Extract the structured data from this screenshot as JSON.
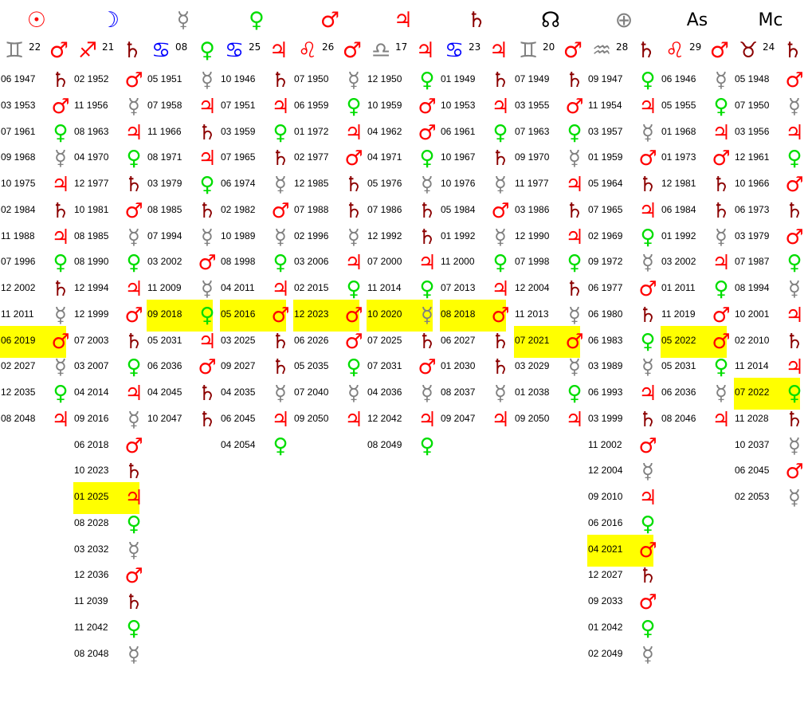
{
  "colors": {
    "sun": "#ff0000",
    "moon": "#0000ff",
    "mercury": "#808080",
    "venus": "#00dd00",
    "mars": "#ff0000",
    "jupiter": "#ff0000",
    "saturn": "#8b0000",
    "node": "#000000",
    "earth": "#808080",
    "asc": "#000000",
    "mc": "#000000",
    "fire": "#ff0000",
    "air": "#808080",
    "water": "#0000ff",
    "earthsign": "#8b0000",
    "highlight": "#ffff00"
  },
  "glyphs": {
    "sun": "☉",
    "moon": "☽",
    "mercury": "☿",
    "venus": "♀",
    "mars": "♂",
    "jupiter": "♃",
    "saturn": "♄",
    "node": "☊",
    "earth": "⊕",
    "asc": "As",
    "mc": "Mc",
    "gemini": "♊",
    "sagittarius": "♐",
    "cancer": "♋",
    "leo": "♌",
    "libra": "♎",
    "aquarius": "♒",
    "taurus": "♉"
  },
  "columns": [
    {
      "point": "sun",
      "point_color": "sun",
      "sign": "gemini",
      "sign_color": "air",
      "degree": "22",
      "ruler": "mars",
      "rows": [
        {
          "date": "06 1947",
          "planet": "saturn"
        },
        {
          "date": "03 1953",
          "planet": "mars"
        },
        {
          "date": "07 1961",
          "planet": "venus"
        },
        {
          "date": "09 1968",
          "planet": "mercury"
        },
        {
          "date": "10 1975",
          "planet": "jupiter"
        },
        {
          "date": "02 1984",
          "planet": "saturn"
        },
        {
          "date": "11 1988",
          "planet": "jupiter"
        },
        {
          "date": "07 1996",
          "planet": "venus"
        },
        {
          "date": "12 2002",
          "planet": "saturn"
        },
        {
          "date": "11 2011",
          "planet": "mercury"
        },
        {
          "date": "06 2019",
          "planet": "mars",
          "highlight": true
        },
        {
          "date": "02 2027",
          "planet": "mercury"
        },
        {
          "date": "12 2035",
          "planet": "venus"
        },
        {
          "date": "08 2048",
          "planet": "jupiter"
        }
      ]
    },
    {
      "point": "moon",
      "point_color": "moon",
      "sign": "sagittarius",
      "sign_color": "fire",
      "degree": "21",
      "ruler": "saturn",
      "rows": [
        {
          "date": "02 1952",
          "planet": "mars"
        },
        {
          "date": "11 1956",
          "planet": "mercury"
        },
        {
          "date": "08 1963",
          "planet": "jupiter"
        },
        {
          "date": "04 1970",
          "planet": "venus"
        },
        {
          "date": "12 1977",
          "planet": "saturn"
        },
        {
          "date": "10 1981",
          "planet": "mars"
        },
        {
          "date": "08 1985",
          "planet": "mercury"
        },
        {
          "date": "08 1990",
          "planet": "venus"
        },
        {
          "date": "12 1994",
          "planet": "jupiter"
        },
        {
          "date": "12 1999",
          "planet": "mars"
        },
        {
          "date": "07 2003",
          "planet": "saturn"
        },
        {
          "date": "03 2007",
          "planet": "venus"
        },
        {
          "date": "04 2014",
          "planet": "jupiter"
        },
        {
          "date": "09 2016",
          "planet": "mercury"
        },
        {
          "date": "06 2018",
          "planet": "mars"
        },
        {
          "date": "10 2023",
          "planet": "saturn"
        },
        {
          "date": "01 2025",
          "planet": "jupiter",
          "highlight": true
        },
        {
          "date": "08 2028",
          "planet": "venus"
        },
        {
          "date": "03 2032",
          "planet": "mercury"
        },
        {
          "date": "12 2036",
          "planet": "mars"
        },
        {
          "date": "11 2039",
          "planet": "saturn"
        },
        {
          "date": "11 2042",
          "planet": "venus"
        },
        {
          "date": "08 2048",
          "planet": "mercury"
        }
      ]
    },
    {
      "point": "mercury",
      "point_color": "mercury",
      "sign": "cancer",
      "sign_color": "water",
      "degree": "08",
      "ruler": "venus",
      "rows": [
        {
          "date": "05 1951",
          "planet": "mercury"
        },
        {
          "date": "07 1958",
          "planet": "jupiter"
        },
        {
          "date": "11 1966",
          "planet": "saturn"
        },
        {
          "date": "08 1971",
          "planet": "jupiter"
        },
        {
          "date": "03 1979",
          "planet": "venus"
        },
        {
          "date": "08 1985",
          "planet": "saturn"
        },
        {
          "date": "07 1994",
          "planet": "mercury"
        },
        {
          "date": "03 2002",
          "planet": "mars"
        },
        {
          "date": "11 2009",
          "planet": "mercury"
        },
        {
          "date": "09 2018",
          "planet": "venus",
          "highlight": true
        },
        {
          "date": "05 2031",
          "planet": "jupiter"
        },
        {
          "date": "06 2036",
          "planet": "mars"
        },
        {
          "date": "04 2045",
          "planet": "saturn"
        },
        {
          "date": "10 2047",
          "planet": "saturn"
        }
      ]
    },
    {
      "point": "venus",
      "point_color": "venus",
      "sign": "cancer",
      "sign_color": "water",
      "degree": "25",
      "ruler": "jupiter",
      "rows": [
        {
          "date": "10 1946",
          "planet": "saturn"
        },
        {
          "date": "07 1951",
          "planet": "jupiter"
        },
        {
          "date": "03 1959",
          "planet": "venus"
        },
        {
          "date": "07 1965",
          "planet": "saturn"
        },
        {
          "date": "06 1974",
          "planet": "mercury"
        },
        {
          "date": "02 1982",
          "planet": "mars"
        },
        {
          "date": "10 1989",
          "planet": "mercury"
        },
        {
          "date": "08 1998",
          "planet": "venus"
        },
        {
          "date": "04 2011",
          "planet": "jupiter"
        },
        {
          "date": "05 2016",
          "planet": "mars",
          "highlight": true
        },
        {
          "date": "03 2025",
          "planet": "saturn"
        },
        {
          "date": "09 2027",
          "planet": "saturn"
        },
        {
          "date": "04 2035",
          "planet": "mercury"
        },
        {
          "date": "06 2045",
          "planet": "jupiter"
        },
        {
          "date": "04 2054",
          "planet": "venus"
        }
      ]
    },
    {
      "point": "mars",
      "point_color": "mars",
      "sign": "leo",
      "sign_color": "fire",
      "degree": "26",
      "ruler": "mars",
      "rows": [
        {
          "date": "07 1950",
          "planet": "mercury"
        },
        {
          "date": "06 1959",
          "planet": "venus"
        },
        {
          "date": "01 1972",
          "planet": "jupiter"
        },
        {
          "date": "02 1977",
          "planet": "mars"
        },
        {
          "date": "12 1985",
          "planet": "saturn"
        },
        {
          "date": "07 1988",
          "planet": "saturn"
        },
        {
          "date": "02 1996",
          "planet": "mercury"
        },
        {
          "date": "03 2006",
          "planet": "jupiter"
        },
        {
          "date": "02 2015",
          "planet": "venus"
        },
        {
          "date": "12 2023",
          "planet": "mars",
          "highlight": true
        },
        {
          "date": "06 2026",
          "planet": "mars"
        },
        {
          "date": "05 2035",
          "planet": "venus"
        },
        {
          "date": "07 2040",
          "planet": "mercury"
        },
        {
          "date": "09 2050",
          "planet": "jupiter"
        }
      ]
    },
    {
      "point": "jupiter",
      "point_color": "jupiter",
      "sign": "libra",
      "sign_color": "air",
      "degree": "17",
      "ruler": "jupiter",
      "rows": [
        {
          "date": "12 1950",
          "planet": "venus"
        },
        {
          "date": "10 1959",
          "planet": "mars"
        },
        {
          "date": "04 1962",
          "planet": "mars"
        },
        {
          "date": "04 1971",
          "planet": "venus"
        },
        {
          "date": "05 1976",
          "planet": "mercury"
        },
        {
          "date": "07 1986",
          "planet": "saturn"
        },
        {
          "date": "12 1992",
          "planet": "saturn"
        },
        {
          "date": "07 2000",
          "planet": "jupiter"
        },
        {
          "date": "11 2014",
          "planet": "venus"
        },
        {
          "date": "10 2020",
          "planet": "mercury",
          "highlight": true
        },
        {
          "date": "07 2025",
          "planet": "saturn"
        },
        {
          "date": "07 2031",
          "planet": "mars"
        },
        {
          "date": "04 2036",
          "planet": "mercury"
        },
        {
          "date": "12 2042",
          "planet": "jupiter"
        },
        {
          "date": "08 2049",
          "planet": "venus"
        }
      ]
    },
    {
      "point": "saturn",
      "point_color": "saturn",
      "sign": "cancer",
      "sign_color": "water",
      "degree": "23",
      "ruler": "jupiter",
      "rows": [
        {
          "date": "01 1949",
          "planet": "saturn"
        },
        {
          "date": "10 1953",
          "planet": "jupiter"
        },
        {
          "date": "06 1961",
          "planet": "venus"
        },
        {
          "date": "10 1967",
          "planet": "saturn"
        },
        {
          "date": "10 1976",
          "planet": "mercury"
        },
        {
          "date": "05 1984",
          "planet": "mars"
        },
        {
          "date": "01 1992",
          "planet": "mercury"
        },
        {
          "date": "11 2000",
          "planet": "venus"
        },
        {
          "date": "07 2013",
          "planet": "jupiter"
        },
        {
          "date": "08 2018",
          "planet": "mars",
          "highlight": true
        },
        {
          "date": "06 2027",
          "planet": "saturn"
        },
        {
          "date": "01 2030",
          "planet": "saturn"
        },
        {
          "date": "08 2037",
          "planet": "mercury"
        },
        {
          "date": "09 2047",
          "planet": "jupiter"
        }
      ]
    },
    {
      "point": "node",
      "point_color": "node",
      "sign": "gemini",
      "sign_color": "air",
      "degree": "20",
      "ruler": "mars",
      "rows": [
        {
          "date": "07 1949",
          "planet": "saturn"
        },
        {
          "date": "03 1955",
          "planet": "mars"
        },
        {
          "date": "07 1963",
          "planet": "venus"
        },
        {
          "date": "09 1970",
          "planet": "mercury"
        },
        {
          "date": "11 1977",
          "planet": "jupiter"
        },
        {
          "date": "03 1986",
          "planet": "saturn"
        },
        {
          "date": "12 1990",
          "planet": "jupiter"
        },
        {
          "date": "07 1998",
          "planet": "venus"
        },
        {
          "date": "12 2004",
          "planet": "saturn"
        },
        {
          "date": "11 2013",
          "planet": "mercury"
        },
        {
          "date": "07 2021",
          "planet": "mars",
          "highlight": true
        },
        {
          "date": "03 2029",
          "planet": "mercury"
        },
        {
          "date": "01 2038",
          "planet": "venus"
        },
        {
          "date": "09 2050",
          "planet": "jupiter"
        }
      ]
    },
    {
      "point": "earth",
      "point_color": "earth",
      "sign": "aquarius",
      "sign_color": "air",
      "degree": "28",
      "ruler": "saturn",
      "rows": [
        {
          "date": "09 1947",
          "planet": "venus"
        },
        {
          "date": "11 1954",
          "planet": "jupiter"
        },
        {
          "date": "03 1957",
          "planet": "mercury"
        },
        {
          "date": "01 1959",
          "planet": "mars"
        },
        {
          "date": "05 1964",
          "planet": "saturn"
        },
        {
          "date": "07 1965",
          "planet": "jupiter"
        },
        {
          "date": "02 1969",
          "planet": "venus"
        },
        {
          "date": "09 1972",
          "planet": "mercury"
        },
        {
          "date": "06 1977",
          "planet": "mars"
        },
        {
          "date": "06 1980",
          "planet": "saturn"
        },
        {
          "date": "06 1983",
          "planet": "venus"
        },
        {
          "date": "03 1989",
          "planet": "mercury"
        },
        {
          "date": "06 1993",
          "planet": "jupiter"
        },
        {
          "date": "03 1999",
          "planet": "saturn"
        },
        {
          "date": "11 2002",
          "planet": "mars"
        },
        {
          "date": "12 2004",
          "planet": "mercury"
        },
        {
          "date": "09 2010",
          "planet": "jupiter"
        },
        {
          "date": "06 2016",
          "planet": "venus"
        },
        {
          "date": "04 2021",
          "planet": "mars",
          "highlight": true
        },
        {
          "date": "12 2027",
          "planet": "saturn"
        },
        {
          "date": "09 2033",
          "planet": "mars"
        },
        {
          "date": "01 2042",
          "planet": "venus"
        },
        {
          "date": "02 2049",
          "planet": "mercury"
        }
      ]
    },
    {
      "point": "asc",
      "point_color": "asc",
      "sign": "leo",
      "sign_color": "fire",
      "degree": "29",
      "ruler": "mars",
      "rows": [
        {
          "date": "06 1946",
          "planet": "mercury"
        },
        {
          "date": "05 1955",
          "planet": "venus"
        },
        {
          "date": "01 1968",
          "planet": "jupiter"
        },
        {
          "date": "01 1973",
          "planet": "mars"
        },
        {
          "date": "12 1981",
          "planet": "saturn"
        },
        {
          "date": "06 1984",
          "planet": "saturn"
        },
        {
          "date": "01 1992",
          "planet": "mercury"
        },
        {
          "date": "03 2002",
          "planet": "jupiter"
        },
        {
          "date": "01 2011",
          "planet": "venus"
        },
        {
          "date": "11 2019",
          "planet": "mars"
        },
        {
          "date": "05 2022",
          "planet": "mars",
          "highlight": true
        },
        {
          "date": "05 2031",
          "planet": "venus"
        },
        {
          "date": "06 2036",
          "planet": "mercury"
        },
        {
          "date": "08 2046",
          "planet": "jupiter"
        }
      ]
    },
    {
      "point": "mc",
      "point_color": "mc",
      "sign": "taurus",
      "sign_color": "earthsign",
      "degree": "24",
      "ruler": "saturn",
      "rows": [
        {
          "date": "05 1948",
          "planet": "mars"
        },
        {
          "date": "07 1950",
          "planet": "mercury"
        },
        {
          "date": "03 1956",
          "planet": "jupiter"
        },
        {
          "date": "12 1961",
          "planet": "venus"
        },
        {
          "date": "10 1966",
          "planet": "mars"
        },
        {
          "date": "06 1973",
          "planet": "saturn"
        },
        {
          "date": "03 1979",
          "planet": "mars"
        },
        {
          "date": "07 1987",
          "planet": "venus"
        },
        {
          "date": "08 1994",
          "planet": "mercury"
        },
        {
          "date": "10 2001",
          "planet": "jupiter"
        },
        {
          "date": "02 2010",
          "planet": "saturn"
        },
        {
          "date": "11 2014",
          "planet": "jupiter"
        },
        {
          "date": "07 2022",
          "planet": "venus",
          "highlight": true
        },
        {
          "date": "11 2028",
          "planet": "saturn"
        },
        {
          "date": "10 2037",
          "planet": "mercury"
        },
        {
          "date": "06 2045",
          "planet": "mars"
        },
        {
          "date": "02 2053",
          "planet": "mercury"
        }
      ]
    }
  ]
}
